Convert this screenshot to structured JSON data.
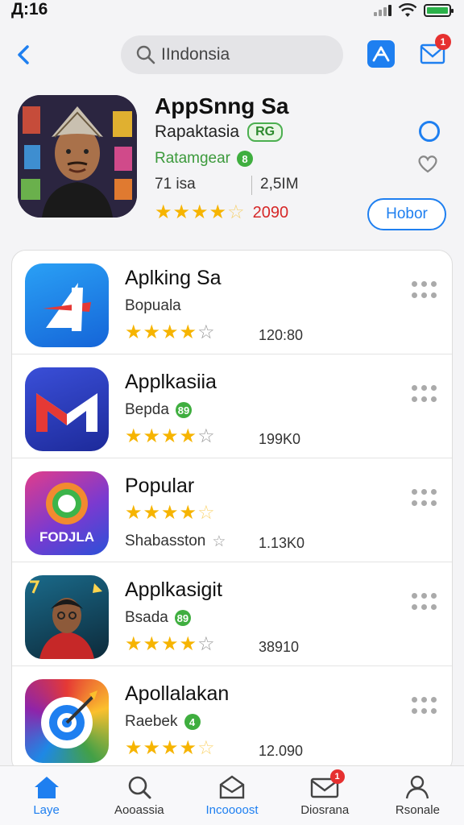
{
  "status": {
    "time": "Д:16"
  },
  "search": {
    "value": "IIndonsia",
    "placeholder": ""
  },
  "nav": {
    "mail_badge": "1"
  },
  "featured": {
    "title": "AppSnng Sa",
    "subtitle": "Rapaktasia",
    "tag": "RG",
    "category": "Ratamgear",
    "category_badge": "8",
    "stat_a": "71 isa",
    "stat_b": "2,5IM",
    "rating_count": "2090",
    "get_label": "Hobor",
    "rating": 4.5
  },
  "apps": [
    {
      "title": "Aplking Sa",
      "subtitle": "Bopuala",
      "badge": "",
      "rating": 4,
      "count": "120:80",
      "icon": "delta-a-icon"
    },
    {
      "title": "Applkasiia",
      "subtitle": "Bepda",
      "badge": "89",
      "rating": 4,
      "count": "199K0",
      "icon": "mail-m-icon"
    },
    {
      "title": "Popular",
      "subtitle": "Shabasston",
      "badge": "",
      "rating": 4,
      "count": "1.13K0",
      "icon": "fodjla-icon",
      "icon_text": "FODJLA"
    },
    {
      "title": "Applkasigit",
      "subtitle": "Bsada",
      "badge": "89",
      "rating": 4,
      "count": "38910",
      "icon": "person-game-icon"
    },
    {
      "title": "Apollalakan",
      "subtitle": "Raebek",
      "badge": "4",
      "rating": 4,
      "count": "12.090",
      "icon": "target-icon"
    }
  ],
  "tabs": [
    {
      "label": "Laye",
      "active": true
    },
    {
      "label": "Aooassia",
      "active": false
    },
    {
      "label": "Incoooost",
      "active": false
    },
    {
      "label": "Diosrana",
      "active": false,
      "badge": "1"
    },
    {
      "label": "Rsonale",
      "active": false
    }
  ],
  "colors": {
    "accent": "#1e7ff0",
    "star": "#f6b400",
    "badge": "#e63030",
    "green": "#3fae3f"
  }
}
